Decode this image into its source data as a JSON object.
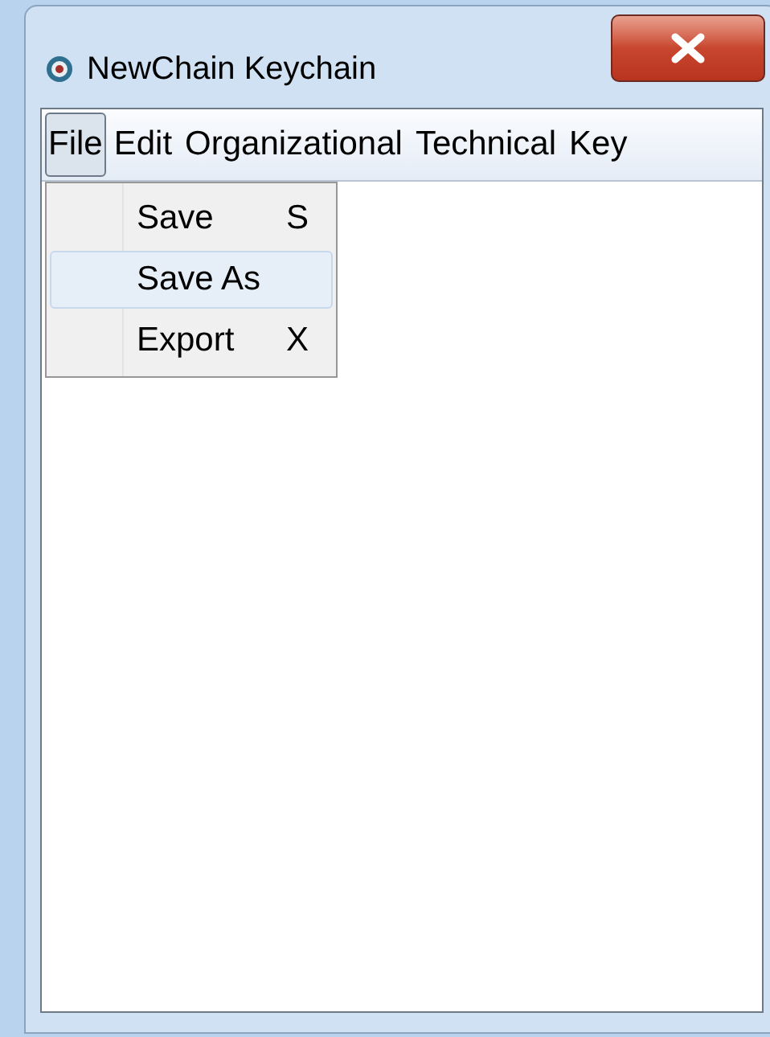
{
  "window": {
    "title": "NewChain Keychain"
  },
  "menu_bar": [
    {
      "label": "File",
      "selected": true
    },
    {
      "label": "Edit",
      "selected": false
    },
    {
      "label": "Organizational",
      "selected": false
    },
    {
      "label": "Technical",
      "selected": false
    },
    {
      "label": "Key",
      "selected": false
    }
  ],
  "dropdown": [
    {
      "label": "Save",
      "shortcut": "S",
      "selected": false
    },
    {
      "label": "Save As",
      "selected": true
    },
    {
      "label": "Export",
      "shortcut": "X",
      "selected": false
    }
  ]
}
